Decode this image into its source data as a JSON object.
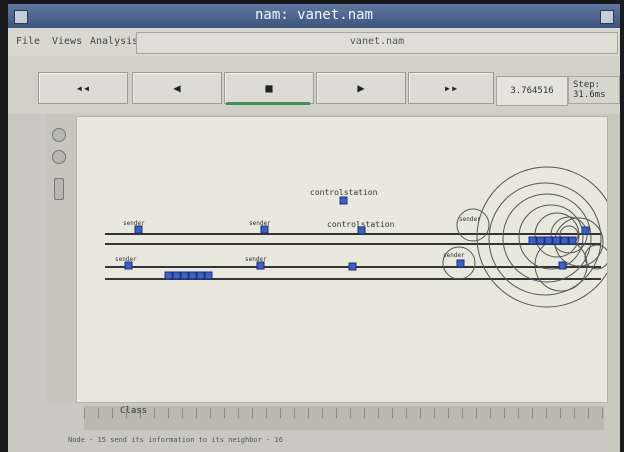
{
  "window": {
    "title": "nam: vanet.nam"
  },
  "menu": {
    "file": "File",
    "views": "Views",
    "analysis": "Analysis"
  },
  "filename": "vanet.nam",
  "controls": {
    "rewind": "◂◂",
    "back": "◀",
    "stop": "■",
    "play": "▶",
    "fast_forward": "▸▸",
    "time": "3.764516",
    "step": "Step: 31.6ms"
  },
  "canvas": {
    "labels": {
      "station_top": "controlstation",
      "station_mid": "controlstation",
      "sender_1": "sender",
      "sender_2": "sender",
      "sender_3": "sender",
      "sender_4": "sender",
      "sender_5": "sender",
      "sender_6": "sender"
    }
  },
  "timeline": {
    "label": "Class"
  },
  "status": {
    "text": "Node - 15 send its information to its neighbor - 16"
  },
  "colors": {
    "node": "#3a5fcf",
    "road": "#333333",
    "titlebar": "#4a6290"
  }
}
